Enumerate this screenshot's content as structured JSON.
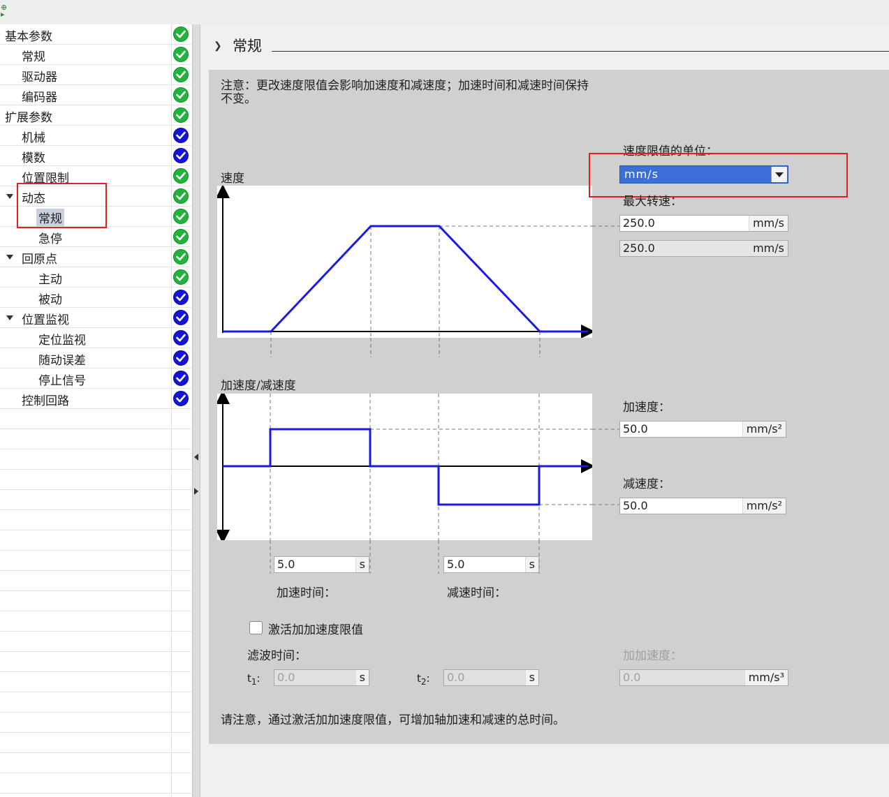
{
  "tree": {
    "items": [
      {
        "label": "基本参数",
        "level": 0,
        "status": "green"
      },
      {
        "label": "常规",
        "level": 1,
        "status": "green"
      },
      {
        "label": "驱动器",
        "level": 1,
        "status": "green"
      },
      {
        "label": "编码器",
        "level": 1,
        "status": "green"
      },
      {
        "label": "扩展参数",
        "level": 0,
        "status": "green"
      },
      {
        "label": "机械",
        "level": 1,
        "status": "blue"
      },
      {
        "label": "模数",
        "level": 1,
        "status": "blue"
      },
      {
        "label": "位置限制",
        "level": 1,
        "status": "green"
      },
      {
        "label": "动态",
        "level": 1,
        "status": "green",
        "expanded": true
      },
      {
        "label": "常规",
        "level": 2,
        "status": "green",
        "selected": true
      },
      {
        "label": "急停",
        "level": 2,
        "status": "green"
      },
      {
        "label": "回原点",
        "level": 1,
        "status": "green",
        "expanded": true
      },
      {
        "label": "主动",
        "level": 2,
        "status": "green"
      },
      {
        "label": "被动",
        "level": 2,
        "status": "blue"
      },
      {
        "label": "位置监视",
        "level": 1,
        "status": "blue",
        "expanded": true
      },
      {
        "label": "定位监视",
        "level": 2,
        "status": "blue"
      },
      {
        "label": "随动误差",
        "level": 2,
        "status": "blue"
      },
      {
        "label": "停止信号",
        "level": 2,
        "status": "blue"
      },
      {
        "label": "控制回路",
        "level": 1,
        "status": "blue"
      }
    ]
  },
  "content": {
    "section_title": "常规",
    "note": "注意：更改速度限值会影响加速度和减速度；加速时间和减速时间保持不变。",
    "speed_chart_label": "速度",
    "accel_chart_label": "加速度/减速度",
    "speed_unit_label": "速度限值的单位：",
    "speed_unit_value": "mm/s",
    "max_speed_label": "最大转速：",
    "max_speed_value": "250.0",
    "max_speed_unit": "mm/s",
    "speed_readonly_value": "250.0",
    "speed_readonly_unit": "mm/s",
    "accel_label": "加速度：",
    "accel_value": "50.0",
    "accel_unit": "mm/s²",
    "decel_label": "减速度：",
    "decel_value": "50.0",
    "decel_unit": "mm/s²",
    "accel_time_value": "5.0",
    "accel_time_unit": "s",
    "accel_time_label": "加速时间：",
    "decel_time_value": "5.0",
    "decel_time_unit": "s",
    "decel_time_label": "减速时间：",
    "jerk_checkbox_label": "激活加加速度限值",
    "jerk_checked": false,
    "filter_time_label": "滤波时间：",
    "t1_label": "t",
    "t1_sub": "1",
    "t1_value": "0.0",
    "t1_unit": "s",
    "t2_label": "t",
    "t2_sub": "2",
    "t2_value": "0.0",
    "t2_unit": "s",
    "jerk_label": "加加速度：",
    "jerk_value": "0.0",
    "jerk_unit": "mm/s³",
    "footer_note": "请注意，通过激活加加速度限值，可增加轴加速和减速的总时间。"
  },
  "colors": {
    "curve": "#1a1ae6",
    "status_green": "#22b33c",
    "status_blue": "#1414d6",
    "highlight": "#e02020",
    "selection": "#3c6ed8"
  }
}
